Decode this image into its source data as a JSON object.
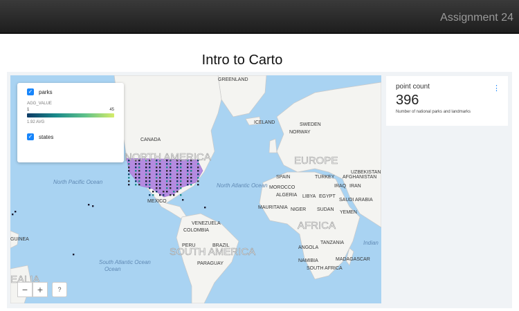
{
  "header": {
    "title": "Assignment 24"
  },
  "page": {
    "title": "Intro to Carto"
  },
  "legend": {
    "layers": [
      {
        "label": "parks",
        "checked": true
      },
      {
        "label": "states",
        "checked": true
      }
    ],
    "agg_label": "AGG_VALUE",
    "range_min": "1",
    "range_max": "45",
    "avg": "1.92 AVG"
  },
  "map_labels": {
    "greenland": "GREENLAND",
    "canada": "CANADA",
    "iceland": "ICELAND",
    "norway": "NORWAY",
    "sweden": "SWEDEN",
    "north_america": "NORTH AMERICA",
    "europe": "EUROPE",
    "uzbekistan": "UZBEKISTAN",
    "spain": "SPAIN",
    "turkey": "TURKEY",
    "afghanistan": "AFGHANISTAN",
    "morocco": "MOROCCO",
    "iraq": "IRAQ",
    "iran": "IRAN",
    "algeria": "ALGERIA",
    "libya": "LIBYA",
    "egypt": "EGYPT",
    "saudi_arabia": "SAUDI ARABIA",
    "mauritania": "MAURITANIA",
    "niger": "NIGER",
    "sudan": "SUDAN",
    "yemen": "YEMEN",
    "africa": "AFRICA",
    "mexico": "MEXICO",
    "venezuela": "VENEZUELA",
    "colombia": "COLOMBIA",
    "brazil": "BRAZIL",
    "peru": "PERU",
    "south_america": "SOUTH AMERICA",
    "paraguay": "PARAGUAY",
    "angola": "ANGOLA",
    "tanzania": "TANZANIA",
    "namibia": "NAMIBIA",
    "madagascar": "MADAGASCAR",
    "south_africa": "SOUTH AFRICA",
    "north_pacific": "North Pacific Ocean",
    "north_atlantic": "North Atlantic Ocean",
    "south_atlantic": "South Atlantic Ocean",
    "indian_ocean": "Indian",
    "guinea": "GUINEA",
    "australia_fragment": "EALIA",
    "ocean_fragment": "Ocean"
  },
  "zoom": {
    "minus": "−",
    "plus": "+",
    "help": "?"
  },
  "widget": {
    "title": "point count",
    "menu": "⋮",
    "value": "396",
    "description": "Number of national parks and landmarks"
  },
  "colors": {
    "accent": "#1785fb",
    "ocean": "#a9d3f2",
    "land": "#f4f4f1",
    "state_fill": "#b48be0"
  }
}
